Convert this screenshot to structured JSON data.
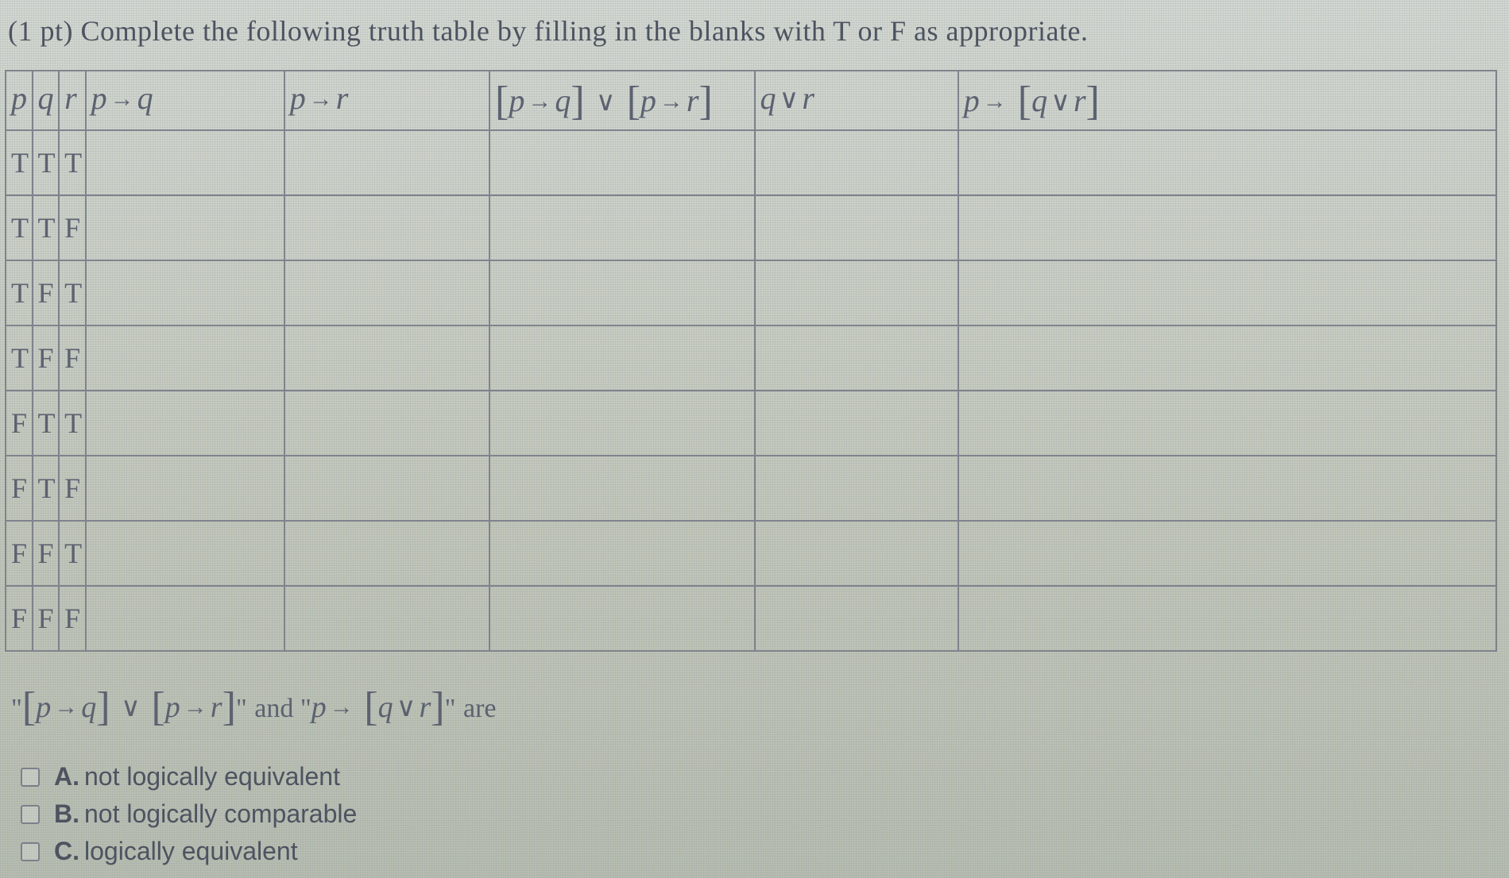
{
  "title": "(1 pt) Complete the following truth table by filling in the blanks with T or F as appropriate.",
  "headers": {
    "p": "p",
    "q": "q",
    "r": "r",
    "p_imp_q": "p → q",
    "p_imp_r": "p → r",
    "disj": "[p → q] ∨ [p → r]",
    "q_or_r": "q ∨ r",
    "p_imp_qr": "p → [q ∨ r]"
  },
  "rows": [
    {
      "p": "T",
      "q": "T",
      "r": "T"
    },
    {
      "p": "T",
      "q": "T",
      "r": "F"
    },
    {
      "p": "T",
      "q": "F",
      "r": "T"
    },
    {
      "p": "T",
      "q": "F",
      "r": "F"
    },
    {
      "p": "F",
      "q": "T",
      "r": "T"
    },
    {
      "p": "F",
      "q": "T",
      "r": "F"
    },
    {
      "p": "F",
      "q": "F",
      "r": "T"
    },
    {
      "p": "F",
      "q": "F",
      "r": "F"
    }
  ],
  "statement": {
    "lhs": "[p → q] ∨ [p → r]",
    "mid": " and ",
    "rhs": "p → [q ∨ r]",
    "tail": " are"
  },
  "choices": [
    {
      "key": "A.",
      "text": "not logically equivalent"
    },
    {
      "key": "B.",
      "text": "not logically comparable"
    },
    {
      "key": "C.",
      "text": "logically equivalent"
    }
  ]
}
